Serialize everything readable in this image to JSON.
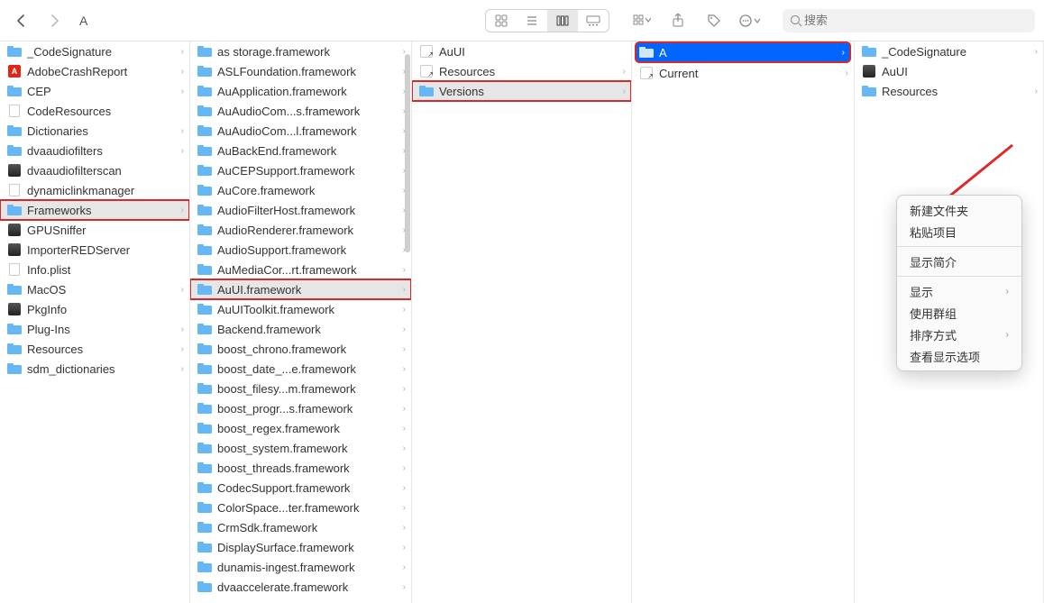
{
  "toolbar": {
    "path_title": "A",
    "search_placeholder": "搜索"
  },
  "columns": {
    "col0": {
      "items": [
        {
          "label": "_CodeSignature",
          "icon": "folder",
          "arrow": true,
          "selected": "",
          "highlight": false
        },
        {
          "label": "AdobeCrashReport",
          "icon": "adobe",
          "arrow": true,
          "selected": "",
          "highlight": false
        },
        {
          "label": "CEP",
          "icon": "folder",
          "arrow": true,
          "selected": "",
          "highlight": false
        },
        {
          "label": "CodeResources",
          "icon": "doc",
          "arrow": false,
          "selected": "",
          "highlight": false
        },
        {
          "label": "Dictionaries",
          "icon": "folder",
          "arrow": true,
          "selected": "",
          "highlight": false
        },
        {
          "label": "dvaaudiofilters",
          "icon": "folder",
          "arrow": true,
          "selected": "",
          "highlight": false
        },
        {
          "label": "dvaaudiofilterscan",
          "icon": "exec",
          "arrow": false,
          "selected": "",
          "highlight": false
        },
        {
          "label": "dynamiclinkmanager",
          "icon": "doc",
          "arrow": false,
          "selected": "",
          "highlight": false
        },
        {
          "label": "Frameworks",
          "icon": "folder",
          "arrow": true,
          "selected": "gray",
          "highlight": true
        },
        {
          "label": "GPUSniffer",
          "icon": "exec",
          "arrow": false,
          "selected": "",
          "highlight": false
        },
        {
          "label": "ImporterREDServer",
          "icon": "exec",
          "arrow": false,
          "selected": "",
          "highlight": false
        },
        {
          "label": "Info.plist",
          "icon": "doc",
          "arrow": false,
          "selected": "",
          "highlight": false
        },
        {
          "label": "MacOS",
          "icon": "folder",
          "arrow": true,
          "selected": "",
          "highlight": false
        },
        {
          "label": "PkgInfo",
          "icon": "exec",
          "arrow": false,
          "selected": "",
          "highlight": false
        },
        {
          "label": "Plug-Ins",
          "icon": "folder",
          "arrow": true,
          "selected": "",
          "highlight": false
        },
        {
          "label": "Resources",
          "icon": "folder",
          "arrow": true,
          "selected": "",
          "highlight": false
        },
        {
          "label": "sdm_dictionaries",
          "icon": "folder",
          "arrow": true,
          "selected": "",
          "highlight": false
        }
      ]
    },
    "col1": {
      "items": [
        {
          "label": "as  storage.framework",
          "icon": "folder",
          "arrow": true,
          "selected": "",
          "highlight": false
        },
        {
          "label": "ASLFoundation.framework",
          "icon": "folder",
          "arrow": true,
          "selected": "",
          "highlight": false
        },
        {
          "label": "AuApplication.framework",
          "icon": "folder",
          "arrow": true,
          "selected": "",
          "highlight": false
        },
        {
          "label": "AuAudioCom...s.framework",
          "icon": "folder",
          "arrow": true,
          "selected": "",
          "highlight": false
        },
        {
          "label": "AuAudioCom...l.framework",
          "icon": "folder",
          "arrow": true,
          "selected": "",
          "highlight": false
        },
        {
          "label": "AuBackEnd.framework",
          "icon": "folder",
          "arrow": true,
          "selected": "",
          "highlight": false
        },
        {
          "label": "AuCEPSupport.framework",
          "icon": "folder",
          "arrow": true,
          "selected": "",
          "highlight": false
        },
        {
          "label": "AuCore.framework",
          "icon": "folder",
          "arrow": true,
          "selected": "",
          "highlight": false
        },
        {
          "label": "AudioFilterHost.framework",
          "icon": "folder",
          "arrow": true,
          "selected": "",
          "highlight": false
        },
        {
          "label": "AudioRenderer.framework",
          "icon": "folder",
          "arrow": true,
          "selected": "",
          "highlight": false
        },
        {
          "label": "AudioSupport.framework",
          "icon": "folder",
          "arrow": true,
          "selected": "",
          "highlight": false
        },
        {
          "label": "AuMediaCor...rt.framework",
          "icon": "folder",
          "arrow": true,
          "selected": "",
          "highlight": false
        },
        {
          "label": "AuUI.framework",
          "icon": "folder",
          "arrow": true,
          "selected": "gray",
          "highlight": true
        },
        {
          "label": "AuUIToolkit.framework",
          "icon": "folder",
          "arrow": true,
          "selected": "",
          "highlight": false
        },
        {
          "label": "Backend.framework",
          "icon": "folder",
          "arrow": true,
          "selected": "",
          "highlight": false
        },
        {
          "label": "boost_chrono.framework",
          "icon": "folder",
          "arrow": true,
          "selected": "",
          "highlight": false
        },
        {
          "label": "boost_date_...e.framework",
          "icon": "folder",
          "arrow": true,
          "selected": "",
          "highlight": false
        },
        {
          "label": "boost_filesy...m.framework",
          "icon": "folder",
          "arrow": true,
          "selected": "",
          "highlight": false
        },
        {
          "label": "boost_progr...s.framework",
          "icon": "folder",
          "arrow": true,
          "selected": "",
          "highlight": false
        },
        {
          "label": "boost_regex.framework",
          "icon": "folder",
          "arrow": true,
          "selected": "",
          "highlight": false
        },
        {
          "label": "boost_system.framework",
          "icon": "folder",
          "arrow": true,
          "selected": "",
          "highlight": false
        },
        {
          "label": "boost_threads.framework",
          "icon": "folder",
          "arrow": true,
          "selected": "",
          "highlight": false
        },
        {
          "label": "CodecSupport.framework",
          "icon": "folder",
          "arrow": true,
          "selected": "",
          "highlight": false
        },
        {
          "label": "ColorSpace...ter.framework",
          "icon": "folder",
          "arrow": true,
          "selected": "",
          "highlight": false
        },
        {
          "label": "CrmSdk.framework",
          "icon": "folder",
          "arrow": true,
          "selected": "",
          "highlight": false
        },
        {
          "label": "DisplaySurface.framework",
          "icon": "folder",
          "arrow": true,
          "selected": "",
          "highlight": false
        },
        {
          "label": "dunamis-ingest.framework",
          "icon": "folder",
          "arrow": true,
          "selected": "",
          "highlight": false
        },
        {
          "label": "dvaaccelerate.framework",
          "icon": "folder",
          "arrow": true,
          "selected": "",
          "highlight": false
        }
      ]
    },
    "col2": {
      "items": [
        {
          "label": "AuUI",
          "icon": "alias",
          "arrow": false,
          "selected": "",
          "highlight": false
        },
        {
          "label": "Resources",
          "icon": "alias",
          "arrow": true,
          "selected": "",
          "highlight": false
        },
        {
          "label": "Versions",
          "icon": "folder",
          "arrow": true,
          "selected": "gray",
          "highlight": true
        }
      ]
    },
    "col3": {
      "items": [
        {
          "label": "A",
          "icon": "folder",
          "arrow": true,
          "selected": "blue",
          "highlight": true
        },
        {
          "label": "Current",
          "icon": "alias",
          "arrow": true,
          "selected": "",
          "highlight": false
        }
      ]
    },
    "col4": {
      "items": [
        {
          "label": "_CodeSignature",
          "icon": "folder",
          "arrow": true,
          "selected": "",
          "highlight": false
        },
        {
          "label": "AuUI",
          "icon": "exec",
          "arrow": false,
          "selected": "",
          "highlight": false
        },
        {
          "label": "Resources",
          "icon": "folder",
          "arrow": true,
          "selected": "",
          "highlight": false
        }
      ]
    }
  },
  "context_menu": {
    "items": [
      {
        "label": "新建文件夹",
        "arrow": false,
        "sep_after": false
      },
      {
        "label": "粘贴项目",
        "arrow": false,
        "sep_after": true
      },
      {
        "label": "显示简介",
        "arrow": false,
        "sep_after": true
      },
      {
        "label": "显示",
        "arrow": true,
        "sep_after": false
      },
      {
        "label": "使用群组",
        "arrow": false,
        "sep_after": false
      },
      {
        "label": "排序方式",
        "arrow": true,
        "sep_after": false
      },
      {
        "label": "查看显示选项",
        "arrow": false,
        "sep_after": false
      }
    ]
  }
}
